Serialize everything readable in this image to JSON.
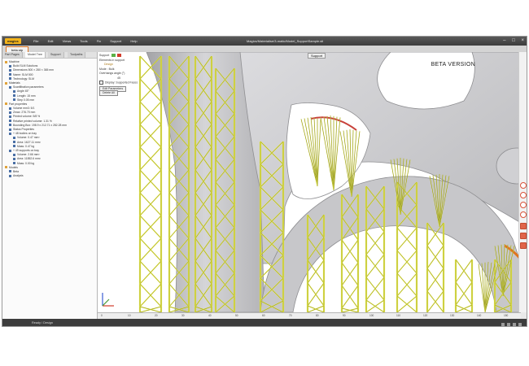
{
  "window": {
    "logo": "magics",
    "title": "Magics/Materialise/3-matic/Model_SupportSample.stl",
    "menu": [
      "File",
      "Edit",
      "Views",
      "Tools",
      "Fix",
      "Support",
      "Help"
    ],
    "controls": [
      "–",
      "□",
      "×"
    ]
  },
  "file_tab": "beta.stp",
  "left_panel": {
    "tabs": [
      "Part Pages",
      "Model Tree",
      "Support",
      "Toolpaths"
    ],
    "active_tab": 1,
    "tree": [
      {
        "label": "Machine",
        "indent": 0,
        "folder": true
      },
      {
        "label": "Build SLM Solutions",
        "indent": 1
      },
      {
        "label": "Dimensions 500 × 280 × 365 mm",
        "indent": 1
      },
      {
        "label": "Name: SLM 500",
        "indent": 1
      },
      {
        "label": "Technology: SLM",
        "indent": 1
      },
      {
        "label": "Materials",
        "indent": 0,
        "folder": true
      },
      {
        "label": "Scanfiltration parameters",
        "indent": 1
      },
      {
        "label": "Angle 45°",
        "indent": 2
      },
      {
        "label": "Length: 15 mm",
        "indent": 2
      },
      {
        "label": "Step 0.05 mm",
        "indent": 2
      },
      {
        "label": "Part properties",
        "indent": 0,
        "folder": true
      },
      {
        "label": "Volume mm3: 5/1",
        "indent": 1
      },
      {
        "label": "Zmax: 276.70 mm",
        "indent": 1
      },
      {
        "label": "Printed volume: 5/8 %",
        "indent": 1
      },
      {
        "label": "Relative printed volume: 1.31 %",
        "indent": 1
      },
      {
        "label": "Bounding Box: 198.9 x 212.71 x 282.28 mm",
        "indent": 1
      },
      {
        "label": "Status Properties",
        "indent": 1
      },
      {
        "label": "+ 48 bodies on tray",
        "indent": 1
      },
      {
        "label": "Volume: 0.47 mm³",
        "indent": 2
      },
      {
        "label": "Area: 1627.11 mm²",
        "indent": 2
      },
      {
        "label": "Mass: 0.47 kg",
        "indent": 2
      },
      {
        "label": "+ 49 supports on tray",
        "indent": 1
      },
      {
        "label": "Volume: 2.66 mm³",
        "indent": 2
      },
      {
        "label": "Area: 11852.6 mm²",
        "indent": 2
      },
      {
        "label": "Mass: 0.00 kg",
        "indent": 2
      },
      {
        "label": "Models",
        "indent": 0,
        "folder": true
      },
      {
        "label": "Beta",
        "indent": 1
      },
      {
        "label": "Analysis",
        "indent": 1
      }
    ]
  },
  "support_panel": {
    "title": "Support",
    "elements_label": "Elements in support",
    "group": "Design",
    "mode": "Mode : Bulk",
    "overhang": "Overhangs angle (°)",
    "angle_value": "45",
    "display_label": "Display: Supported Faces",
    "edit_button": "Edit Parameters",
    "delete_button": "Delete All"
  },
  "viewport": {
    "view_label": "Support",
    "beta_label": "BETA VERSION",
    "ruler_ticks": [
      "0",
      "10",
      "20",
      "30",
      "40",
      "50",
      "60",
      "70",
      "80",
      "90",
      "100",
      "110",
      "120",
      "130",
      "140",
      "150"
    ]
  },
  "status": {
    "text": "Ready / Design"
  },
  "colors": {
    "support": "#e6e94a",
    "support_edge": "#6d6f1e",
    "model": "#cfcfd2",
    "model_dark": "#a7a7aa",
    "accent": "#e0751f",
    "axis_x": "#d33c2c",
    "axis_y": "#4a9a3a",
    "axis_z": "#3a5ed3"
  },
  "icons": [
    "gear-icon",
    "rotate-icon",
    "zoom-icon",
    "pan-icon",
    "measure-icon",
    "layers-icon",
    "slice-icon"
  ]
}
